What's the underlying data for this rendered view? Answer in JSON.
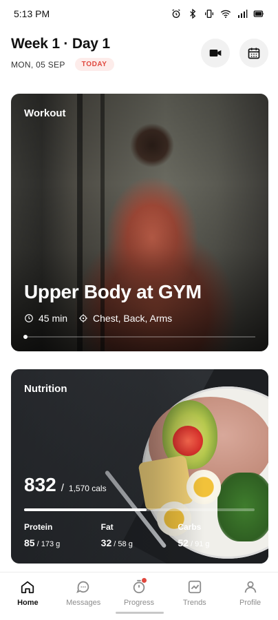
{
  "status_bar": {
    "time": "5:13 PM",
    "icons": [
      "alarm-icon",
      "bluetooth-icon",
      "vibrate-icon",
      "wifi-icon",
      "signal-icon",
      "battery-icon"
    ]
  },
  "header": {
    "title": "Week 1 · Day 1",
    "date": "MON, 05 SEP",
    "badge": "TODAY",
    "actions": [
      "video-camera-icon",
      "calendar-icon"
    ]
  },
  "workout_card": {
    "label": "Workout",
    "title": "Upper Body at GYM",
    "duration": "45 min",
    "muscles": "Chest, Back, Arms",
    "image": "Man standing shirtless in a gym"
  },
  "nutrition_card": {
    "label": "Nutrition",
    "calories": "832",
    "separator": "/",
    "calorie_goal": "1,570 cals",
    "calorie_progress_percent": 53,
    "macros": [
      {
        "name": "Protein",
        "value": "85",
        "goal": " / 173 g"
      },
      {
        "name": "Fat",
        "value": "32",
        "goal": " / 58 g"
      },
      {
        "name": "Carbs",
        "value": "52",
        "goal": " / 91 g"
      }
    ],
    "image": "Plate with avocado, tomato, cheese, eggs, meat and greens"
  },
  "bottom_nav": [
    {
      "label": "Home",
      "icon": "home-icon",
      "active": true
    },
    {
      "label": "Messages",
      "icon": "chat-icon",
      "active": false
    },
    {
      "label": "Progress",
      "icon": "progress-icon",
      "active": false,
      "notification": true
    },
    {
      "label": "Trends",
      "icon": "trends-icon",
      "active": false
    },
    {
      "label": "Profile",
      "icon": "profile-icon",
      "active": false
    }
  ],
  "colors": {
    "accent": "#e0483e",
    "badge_bg": "#fdecea",
    "nav_inactive": "#8c8c8c"
  }
}
